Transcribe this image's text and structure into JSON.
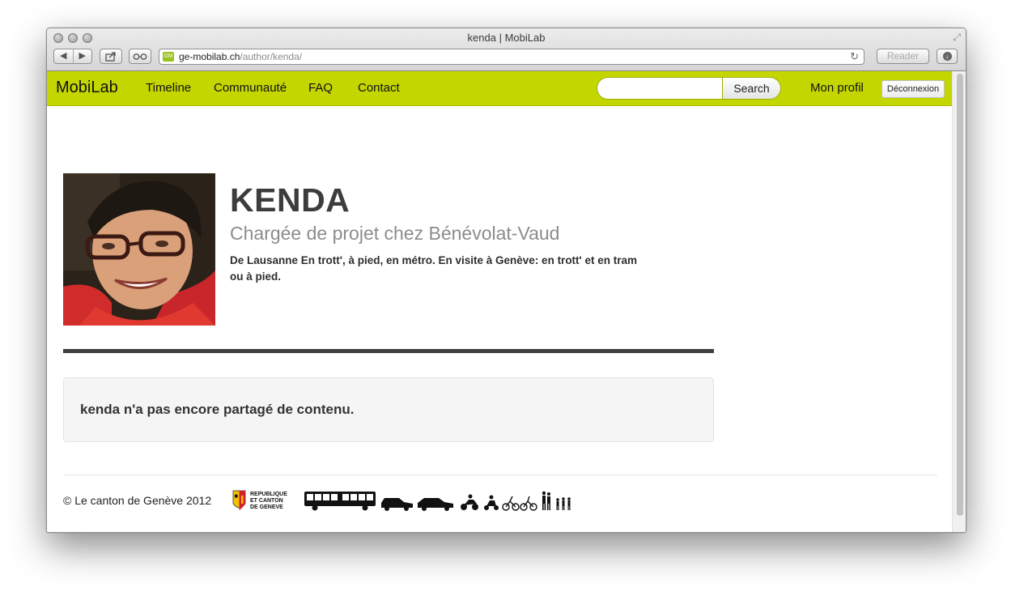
{
  "browser": {
    "window_title": "kenda | MobiLab",
    "url_domain": "ge-mobilab.ch",
    "url_path": "/author/kenda/",
    "favicon_text": "GM",
    "reader_label": "Reader"
  },
  "navbar": {
    "brand": "MobiLab",
    "links": [
      "Timeline",
      "Communauté",
      "FAQ",
      "Contact"
    ],
    "search_placeholder": "",
    "search_button": "Search",
    "profile_link": "Mon profil",
    "logout_button": "Déconnexion"
  },
  "profile": {
    "name": "KENDA",
    "job": "Chargée de projet chez Bénévolat-Vaud",
    "bio": "De Lausanne En trott', à pied, en métro. En visite à Genève: en trott' et en tram ou à pied."
  },
  "content": {
    "empty_message": "kenda n'a pas encore partagé de contenu."
  },
  "footer": {
    "copyright": "© Le canton de Genève 2012",
    "logo_lines": [
      "REPUBLIQUE",
      "ET CANTON",
      "DE GENEVE"
    ]
  },
  "colors": {
    "accent": "#c4d600"
  }
}
